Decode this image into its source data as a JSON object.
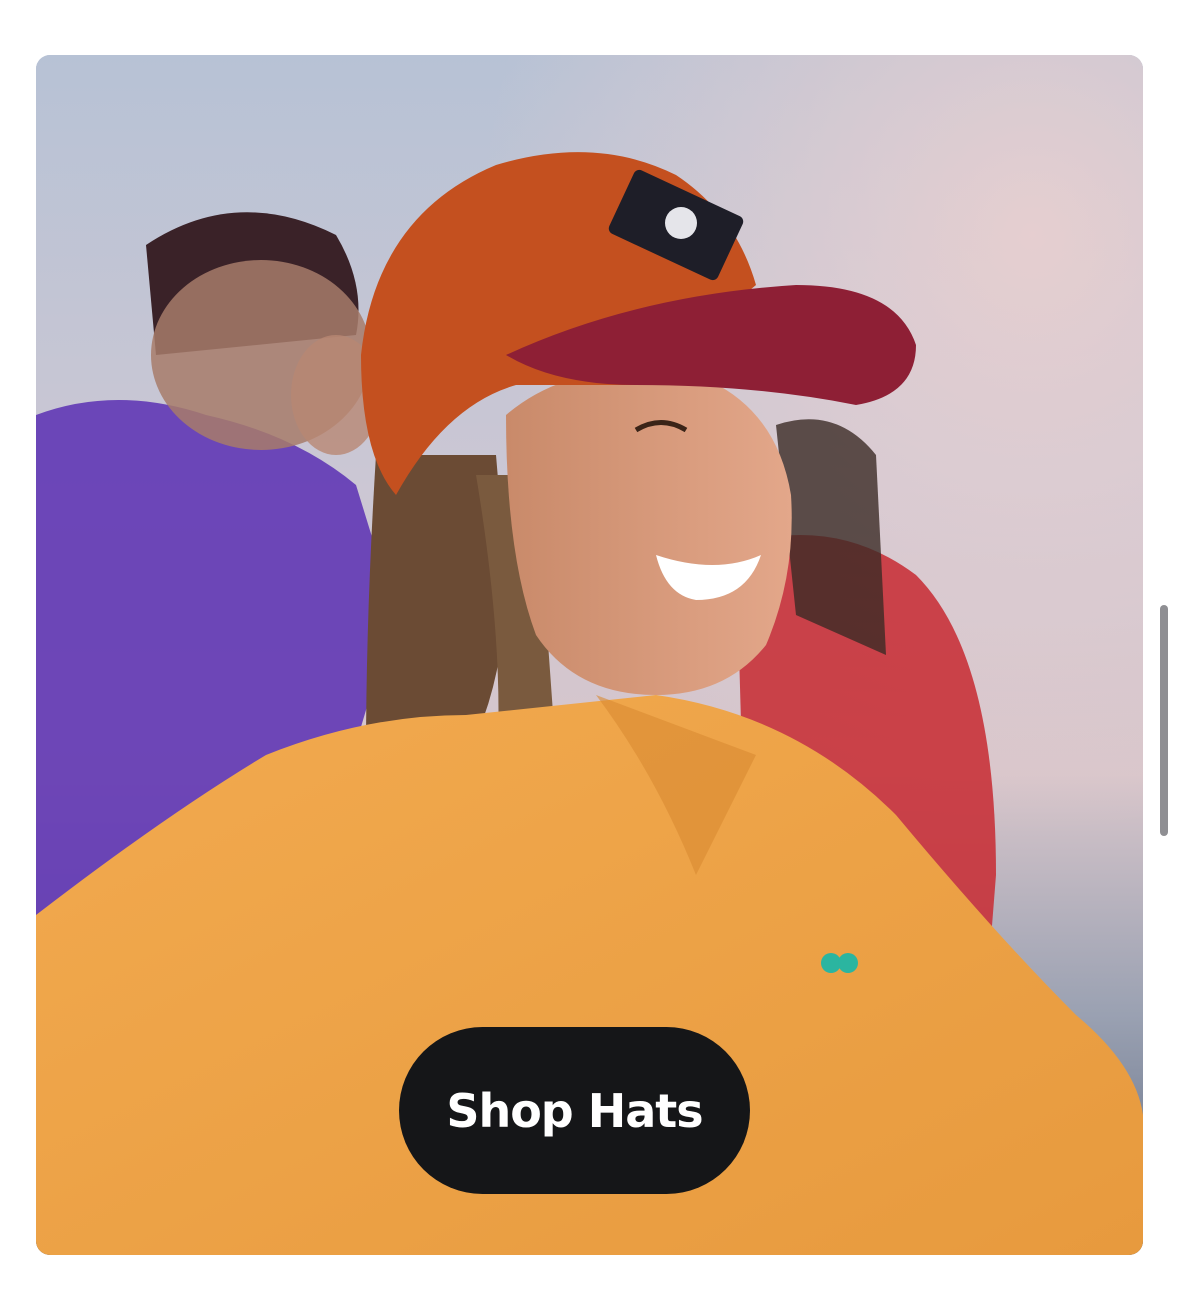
{
  "hero": {
    "image_description_icon": "hero-photo",
    "cta_label": "Shop Hats"
  },
  "colors": {
    "button_bg": "#151618",
    "button_text": "#ffffff",
    "scrollbar": "#8f8f93"
  }
}
